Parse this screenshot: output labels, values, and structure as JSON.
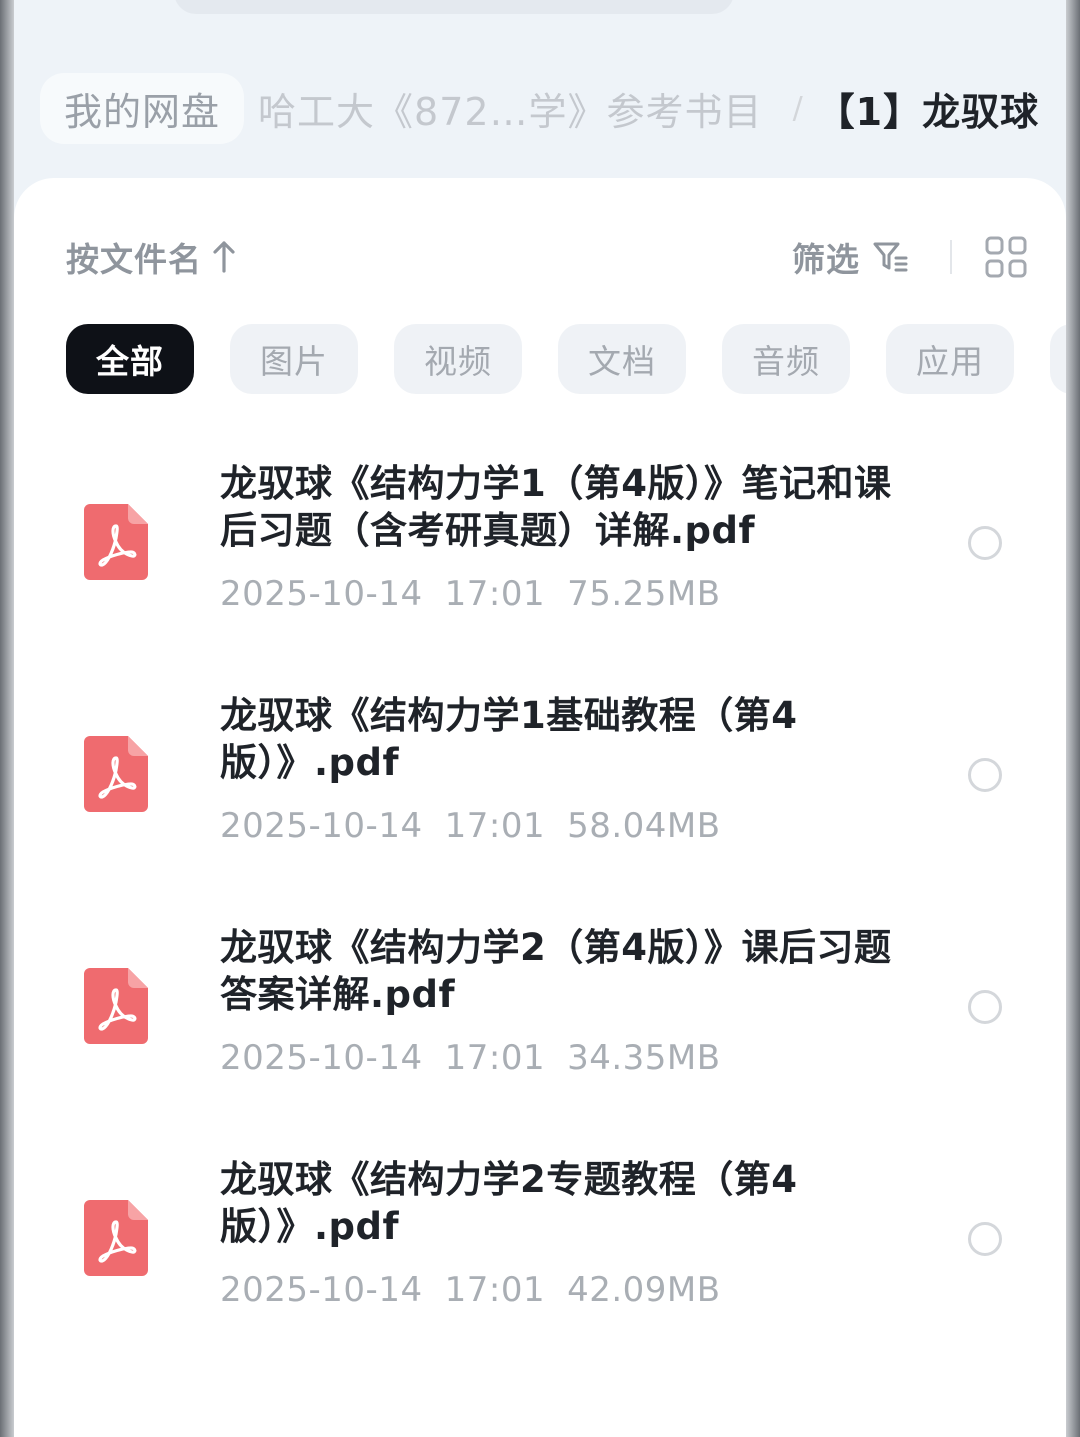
{
  "breadcrumb": {
    "root": "我的网盘",
    "middle": "哈工大《872…学》参考书目",
    "separator": "/",
    "current": "【1】龙驭球"
  },
  "toolbar": {
    "sort_label": "按文件名",
    "sort_direction_icon": "arrow-up-icon",
    "filter_label": "筛选",
    "filter_icon": "filter-icon",
    "view_icon": "grid-view-icon"
  },
  "categories": [
    {
      "label": "全部",
      "active": true
    },
    {
      "label": "图片",
      "active": false
    },
    {
      "label": "视频",
      "active": false
    },
    {
      "label": "文档",
      "active": false
    },
    {
      "label": "音频",
      "active": false
    },
    {
      "label": "应用",
      "active": false
    }
  ],
  "files": [
    {
      "name": "龙驭球《结构力学1（第4版）》笔记和课后习题（含考研真题）详解.pdf",
      "date": "2025-10-14",
      "time": "17:01",
      "size": "75.25MB",
      "icon": "pdf-file-icon"
    },
    {
      "name": "龙驭球《结构力学1基础教程（第4版）》.pdf",
      "date": "2025-10-14",
      "time": "17:01",
      "size": "58.04MB",
      "icon": "pdf-file-icon"
    },
    {
      "name": "龙驭球《结构力学2（第4版）》课后习题答案详解.pdf",
      "date": "2025-10-14",
      "time": "17:01",
      "size": "34.35MB",
      "icon": "pdf-file-icon"
    },
    {
      "name": "龙驭球《结构力学2专题教程（第4版）》.pdf",
      "date": "2025-10-14",
      "time": "17:01",
      "size": "42.09MB",
      "icon": "pdf-file-icon"
    }
  ],
  "colors": {
    "pdf_icon": "#ef6b6f",
    "active_chip": "#0e1117",
    "background": "#eef3f8"
  }
}
